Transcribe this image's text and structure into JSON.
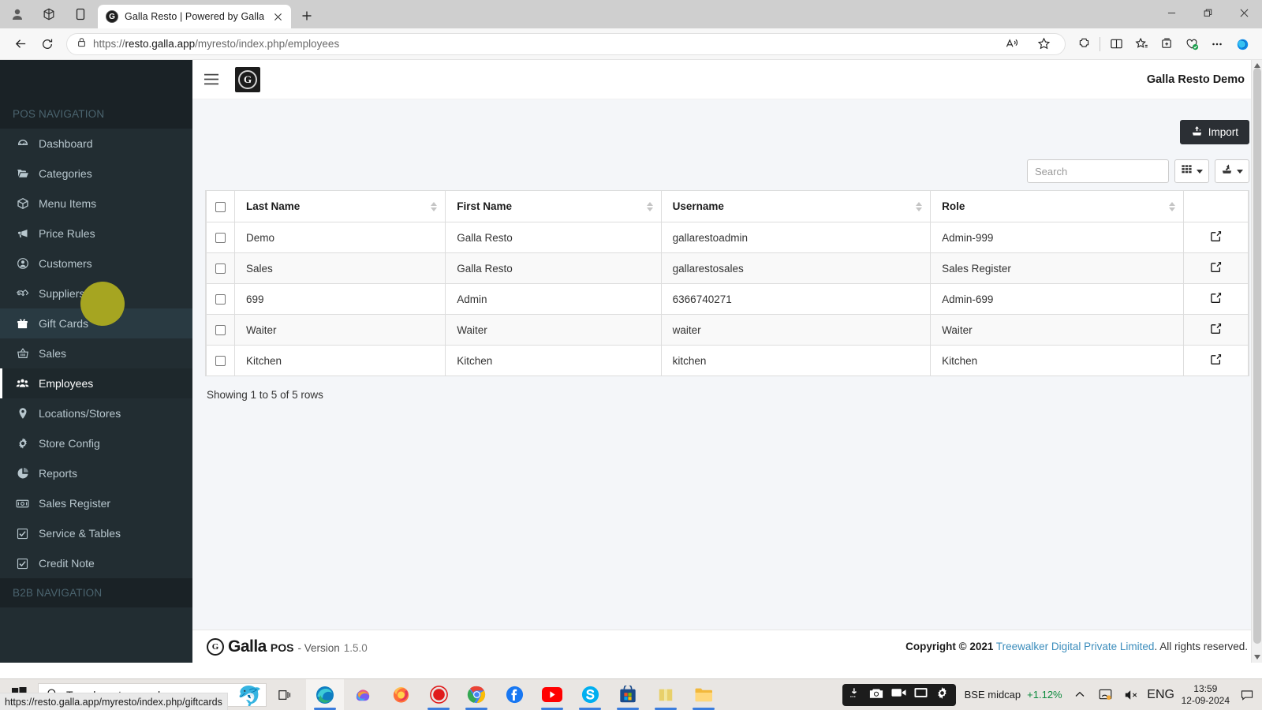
{
  "browser": {
    "tab": {
      "title": "Galla Resto | Powered by Galla",
      "favicon": "G"
    },
    "newtab_tooltip": "New tab",
    "url_prefix": "https://",
    "url_host": "resto.galla.app",
    "url_path": "/myresto/index.php/employees",
    "url_full": "https://resto.galla.app/myresto/index.php/employees",
    "toolbar_icons": [
      "read-aloud-icon",
      "favorite-star-icon",
      "extensions-icon",
      "split-screen-icon",
      "collections-icon",
      "browser-essentials-icon",
      "settings-more-icon",
      "copilot-icon"
    ],
    "window_controls": [
      "minimize",
      "restore",
      "close"
    ],
    "status_link": "https://resto.galla.app/myresto/index.php/giftcards"
  },
  "sidebar": {
    "section_pos": "POS NAVIGATION",
    "section_b2b": "B2B NAVIGATION",
    "items": [
      {
        "label": "Dashboard",
        "icon": "dashboard-icon",
        "state": "normal"
      },
      {
        "label": "Categories",
        "icon": "folder-open-icon",
        "state": "normal"
      },
      {
        "label": "Menu Items",
        "icon": "cube-icon",
        "state": "normal"
      },
      {
        "label": "Price Rules",
        "icon": "bullhorn-icon",
        "state": "normal"
      },
      {
        "label": "Customers",
        "icon": "user-circle-icon",
        "state": "normal"
      },
      {
        "label": "Suppliers",
        "icon": "handshake-icon",
        "state": "normal"
      },
      {
        "label": "Gift Cards",
        "icon": "gift-icon",
        "state": "hover"
      },
      {
        "label": "Sales",
        "icon": "basket-icon",
        "state": "normal"
      },
      {
        "label": "Employees",
        "icon": "users-icon",
        "state": "active"
      },
      {
        "label": "Locations/Stores",
        "icon": "map-pin-icon",
        "state": "normal"
      },
      {
        "label": "Store Config",
        "icon": "gear-icon",
        "state": "normal"
      },
      {
        "label": "Reports",
        "icon": "pie-chart-icon",
        "state": "normal"
      },
      {
        "label": "Sales Register",
        "icon": "cash-register-icon",
        "state": "normal"
      },
      {
        "label": "Service & Tables",
        "icon": "check-square-icon",
        "state": "normal"
      },
      {
        "label": "Credit Note",
        "icon": "check-square-icon",
        "state": "normal"
      }
    ]
  },
  "app_header": {
    "menu_toggle": "hamburger-icon",
    "logo_letter": "G",
    "user_label": "Galla Resto Demo"
  },
  "toolbar": {
    "import_label": "Import",
    "import_icon": "upload-icon",
    "search_placeholder": "Search",
    "search_value": "",
    "columns_icon": "grid-columns-icon",
    "export_icon": "export-icon"
  },
  "table": {
    "columns": [
      "",
      "Last Name",
      "First Name",
      "Username",
      "Role",
      ""
    ],
    "rows": [
      {
        "last_name": "Demo",
        "first_name": "Galla Resto",
        "username": "gallarestoadmin",
        "role": "Admin-999",
        "action": "edit-icon"
      },
      {
        "last_name": "Sales",
        "first_name": "Galla Resto",
        "username": "gallarestosales",
        "role": "Sales Register",
        "action": "edit-icon"
      },
      {
        "last_name": "699",
        "first_name": "Admin",
        "username": "6366740271",
        "role": "Admin-699",
        "action": "edit-icon"
      },
      {
        "last_name": "Waiter",
        "first_name": "Waiter",
        "username": "waiter",
        "role": "Waiter",
        "action": "edit-icon"
      },
      {
        "last_name": "Kitchen",
        "first_name": "Kitchen",
        "username": "kitchen",
        "role": "Kitchen",
        "action": "edit-icon"
      }
    ],
    "showing": "Showing 1 to 5 of 5 rows"
  },
  "footer": {
    "brand_mark": "G",
    "brand_name": "Galla",
    "brand_pos": "POS",
    "version_label": "- Version",
    "version_number": "1.5.0",
    "copyright_prefix": "Copyright © 2021",
    "copyright_link": "Treewalker Digital Private Limited",
    "copyright_suffix": ". All rights reserved."
  },
  "taskbar": {
    "search_placeholder": "Type here to search",
    "apps": [
      "edge-icon",
      "copilot-icon",
      "firefox-icon",
      "recorder-icon",
      "chrome-icon",
      "facebook-icon",
      "youtube-icon",
      "skype-icon",
      "microsoft-store-icon",
      "app-icon",
      "file-explorer-icon"
    ],
    "recorder_tools": [
      "screenshot-region-icon",
      "camera-icon",
      "video-icon",
      "window-icon",
      "settings-gear-icon"
    ],
    "stock_name": "BSE midcap",
    "stock_change": "+1.12%",
    "language": "ENG",
    "time": "13:59",
    "date": "12-09-2024",
    "tray_icons": [
      "show-hidden-icons-chevron",
      "network-icon",
      "volume-muted-icon"
    ]
  },
  "colors": {
    "sidebar_bg": "#222d32",
    "sidebar_header_bg": "#1a2226",
    "sidebar_active_bg": "#1e282c",
    "accent_link": "#3c8dbc",
    "import_btn_bg": "#2b2f34",
    "cursor_highlight": "#a6a521",
    "stock_positive": "#0a8a3c"
  }
}
